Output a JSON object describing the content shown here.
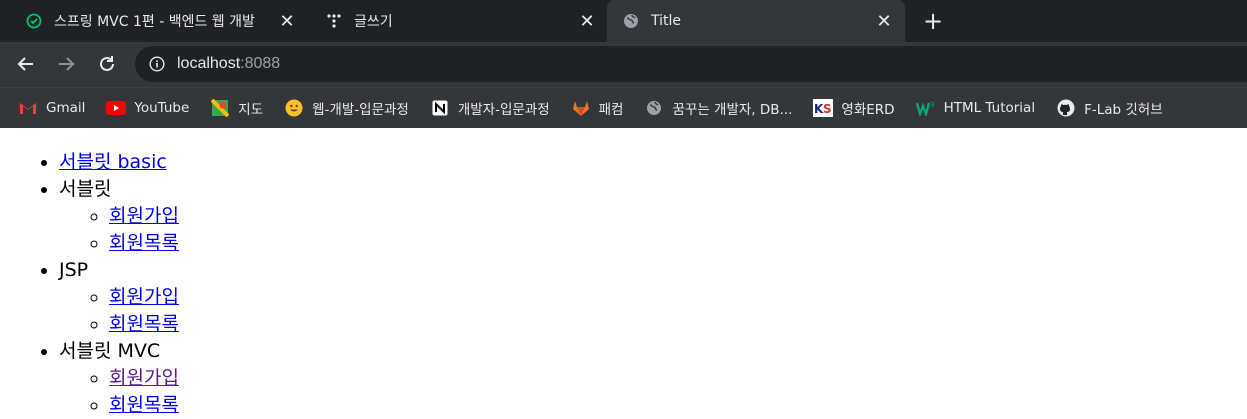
{
  "browser": {
    "tabs": [
      {
        "title": "스프링 MVC 1편 - 백엔드 웹 개발",
        "icon": "inflearn-icon",
        "active": false
      },
      {
        "title": "글쓰기",
        "icon": "tistory-icon",
        "active": false
      },
      {
        "title": "Title",
        "icon": "globe-icon",
        "active": true
      }
    ],
    "new_tab_label": "+",
    "close_label": "✕",
    "url": {
      "host": "localhost",
      "port": ":8088"
    },
    "bookmarks": [
      {
        "label": "Gmail",
        "icon": "gmail-icon"
      },
      {
        "label": "YouTube",
        "icon": "youtube-icon"
      },
      {
        "label": "지도",
        "icon": "maps-icon"
      },
      {
        "label": "웹-개발-입문과정",
        "icon": "smiley-icon"
      },
      {
        "label": "개발자-입문과정",
        "icon": "notion-icon"
      },
      {
        "label": "패컴",
        "icon": "gitlab-icon"
      },
      {
        "label": "꿈꾸는 개발자, DB...",
        "icon": "globe-icon"
      },
      {
        "label": "영화ERD",
        "icon": "ks-icon"
      },
      {
        "label": "HTML Tutorial",
        "icon": "w3schools-icon"
      },
      {
        "label": "F-Lab 깃허브",
        "icon": "github-icon"
      }
    ]
  },
  "page": {
    "items": [
      {
        "label": "서블릿 basic",
        "link": true
      },
      {
        "label": "서블릿",
        "children": [
          "회원가입",
          "회원목록"
        ]
      },
      {
        "label": "JSP",
        "children": [
          "회원가입",
          "회원목록"
        ]
      },
      {
        "label": "서블릿 MVC",
        "children": [
          "회원가입",
          "회원목록"
        ]
      }
    ]
  },
  "colors": {
    "chrome_dark": "#202124",
    "chrome_tab": "#35363a",
    "link": "#0000ee",
    "visited": "#551a8b"
  }
}
